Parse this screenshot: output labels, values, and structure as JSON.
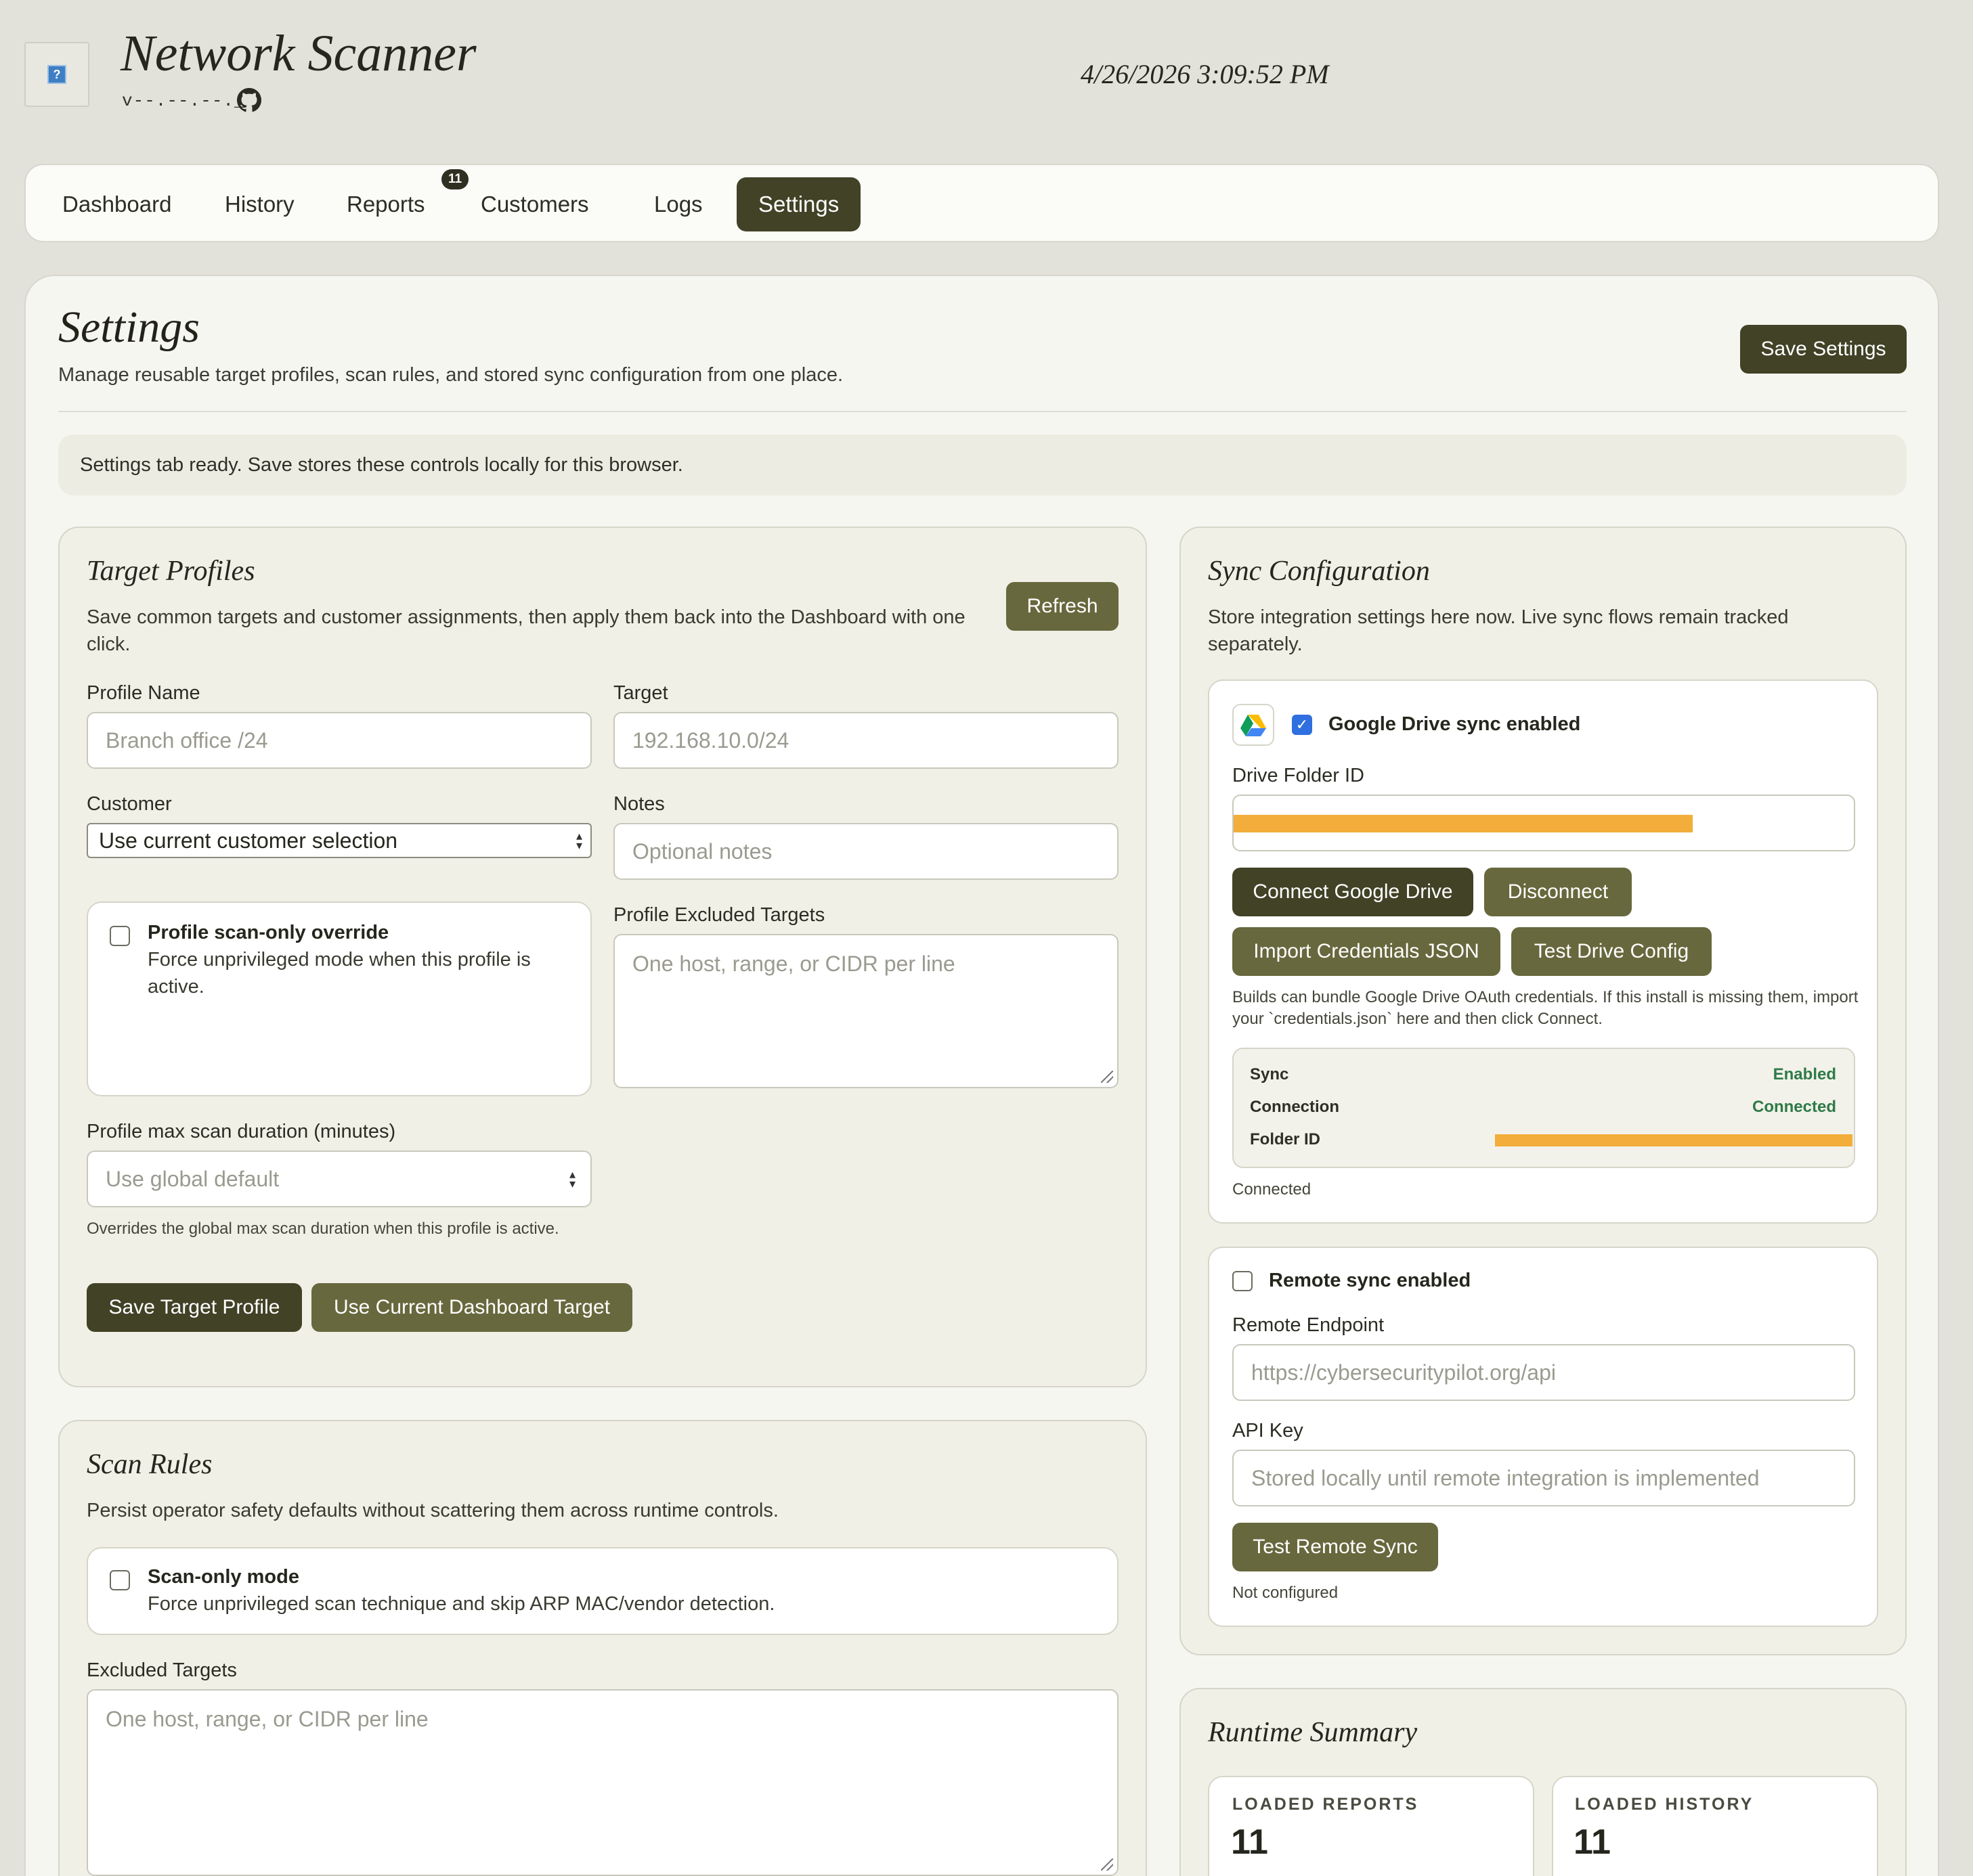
{
  "app": {
    "title": "Network Scanner",
    "version": "v--.--.--._",
    "datetime": "4/26/2026 3:09:52 PM"
  },
  "tabs": [
    {
      "label": "Dashboard",
      "active": false
    },
    {
      "label": "History",
      "active": false
    },
    {
      "label": "Reports",
      "active": false,
      "badge": "11"
    },
    {
      "label": "Customers",
      "active": false
    },
    {
      "label": "Logs",
      "active": false
    },
    {
      "label": "Settings",
      "active": true
    }
  ],
  "settings": {
    "title": "Settings",
    "subtitle": "Manage reusable target profiles, scan rules, and stored sync configuration from one place.",
    "save_label": "Save Settings",
    "status_message": "Settings tab ready. Save stores these controls locally for this browser."
  },
  "target_profiles": {
    "title": "Target Profiles",
    "description": "Save common targets and customer assignments, then apply them back into the Dashboard with one click.",
    "refresh_label": "Refresh",
    "profile_name_label": "Profile Name",
    "profile_name_placeholder": "Branch office /24",
    "target_label": "Target",
    "target_placeholder": "192.168.10.0/24",
    "customer_label": "Customer",
    "customer_selected": "Use current customer selection",
    "notes_label": "Notes",
    "notes_placeholder": "Optional notes",
    "scan_only_override_title": "Profile scan-only override",
    "scan_only_override_desc": "Force unprivileged mode when this profile is active.",
    "excluded_label": "Profile Excluded Targets",
    "excluded_placeholder": "One host, range, or CIDR per line",
    "max_duration_label": "Profile max scan duration (minutes)",
    "max_duration_placeholder": "Use global default",
    "max_duration_help": "Overrides the global max scan duration when this profile is active.",
    "save_profile_label": "Save Target Profile",
    "use_dashboard_label": "Use Current Dashboard Target"
  },
  "scan_rules": {
    "title": "Scan Rules",
    "description": "Persist operator safety defaults without scattering them across runtime controls.",
    "scan_only_title": "Scan-only mode",
    "scan_only_desc": "Force unprivileged scan technique and skip ARP MAC/vendor detection.",
    "excluded_label": "Excluded Targets",
    "excluded_placeholder": "One host, range, or CIDR per line"
  },
  "sync": {
    "title": "Sync Configuration",
    "description": "Store integration settings here now. Live sync flows remain tracked separately.",
    "gdrive_enabled_label": "Google Drive sync enabled",
    "gdrive_enabled": true,
    "drive_folder_label": "Drive Folder ID",
    "connect_label": "Connect Google Drive",
    "disconnect_label": "Disconnect",
    "import_label": "Import Credentials JSON",
    "test_drive_label": "Test Drive Config",
    "help_text": "Builds can bundle Google Drive OAuth credentials. If this install is missing them, import your `credentials.json` here and then click Connect.",
    "status": [
      {
        "key": "Sync",
        "value": "Enabled"
      },
      {
        "key": "Connection",
        "value": "Connected"
      },
      {
        "key": "Folder ID",
        "value": ""
      }
    ],
    "gdrive_status": "Connected",
    "remote_enabled_label": "Remote sync enabled",
    "remote_enabled": false,
    "remote_endpoint_label": "Remote Endpoint",
    "remote_endpoint_placeholder": "https://cybersecuritypilot.org/api",
    "api_key_label": "API Key",
    "api_key_placeholder": "Stored locally until remote integration is implemented",
    "test_remote_label": "Test Remote Sync",
    "remote_status": "Not configured"
  },
  "runtime": {
    "title": "Runtime Summary",
    "loaded_reports_label": "LOADED REPORTS",
    "loaded_reports_value": "11",
    "loaded_history_label": "LOADED HISTORY",
    "loaded_history_value": "11"
  },
  "colors": {
    "accent_dark": "#414226",
    "accent_olive": "#67683d",
    "status_green": "#2f7a48",
    "redaction": "#f2ad3a"
  }
}
